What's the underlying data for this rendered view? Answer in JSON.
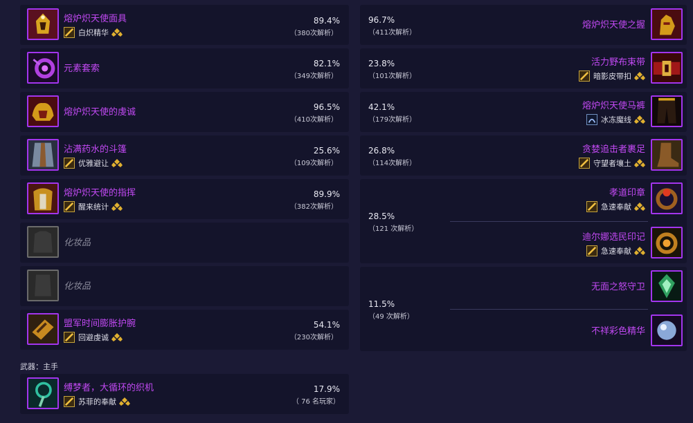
{
  "left": [
    {
      "name": "熔炉炽天使面具",
      "enchant": "白炽精华",
      "pct": "89.4%",
      "count": "（380次解析）",
      "icon": "gold-helm-icon",
      "enchant_icon": "essence-icon"
    },
    {
      "name": "元素套索",
      "pct": "82.1%",
      "count": "（349次解析）",
      "icon": "purple-lasso-icon"
    },
    {
      "name": "熔炉炽天使的虔诚",
      "pct": "96.5%",
      "count": "（410次解析）",
      "icon": "gold-shoulder-icon"
    },
    {
      "name": "沾满药水的斗篷",
      "enchant": "优雅避让",
      "pct": "25.6%",
      "count": "（109次解析）",
      "icon": "cloak-icon",
      "enchant_icon": "scroll-icon"
    },
    {
      "name": "熔炉炽天使的指挥",
      "enchant": "醒来统计",
      "pct": "89.9%",
      "count": "（382次解析）",
      "icon": "gold-chest-icon",
      "enchant_icon": "scroll-icon"
    },
    {
      "name": "化妆品",
      "icon": "empty-shirt-icon"
    },
    {
      "name": "化妆品",
      "icon": "empty-tabard-icon"
    },
    {
      "name": "盟军时间膨胀护腕",
      "enchant": "回避虔诚",
      "pct": "54.1%",
      "count": "（230次解析）",
      "icon": "bracer-icon",
      "enchant_icon": "scroll-icon"
    }
  ],
  "weapon_label": "武器：主手",
  "weapon": {
    "name": "缚梦者，大循环的织机",
    "enchant": "苏菲的奉献",
    "pct": "17.9%",
    "count": "（ 76 名玩家）",
    "icon": "staff-icon",
    "enchant_icon": "scroll-icon"
  },
  "right": [
    {
      "name": "熔炉炽天使之握",
      "pct": "96.7%",
      "count": "（411次解析）",
      "icon": "gold-glove-icon"
    },
    {
      "name": "活力野布束带",
      "enchant": "暗影皮带扣",
      "pct": "23.8%",
      "count": "（101次解析）",
      "icon": "belt-icon",
      "enchant_icon": "buckle-icon"
    },
    {
      "name": "熔炉炽天使马裤",
      "enchant": "冰冻魔线",
      "pct": "42.1%",
      "count": "（179次解析）",
      "icon": "pants-icon",
      "enchant_icon": "thread-icon"
    },
    {
      "name": "贪婪追击者裹足",
      "enchant": "守望者壤土",
      "pct": "26.8%",
      "count": "（114次解析）",
      "icon": "boots-icon",
      "enchant_icon": "scroll-icon"
    }
  ],
  "rings": {
    "pct": "28.5%",
    "count": "（121 次解析）",
    "items": [
      {
        "name": "孝道印章",
        "enchant": "急速奉献",
        "icon": "ring-icon",
        "enchant_icon": "scroll-icon"
      },
      {
        "name": "迪尔娜选民印记",
        "enchant": "急速奉献",
        "icon": "ring-icon",
        "enchant_icon": "scroll-icon"
      }
    ]
  },
  "trinkets": {
    "pct": "11.5%",
    "count": "（49 次解析）",
    "items": [
      {
        "name": "无面之怒守卫",
        "icon": "green-crest-icon"
      },
      {
        "name": "不祥彩色精华",
        "icon": "orb-icon"
      }
    ]
  },
  "colors": {
    "epic": "#c149f2",
    "bg": "#1b1a35",
    "card": "#14142b"
  }
}
